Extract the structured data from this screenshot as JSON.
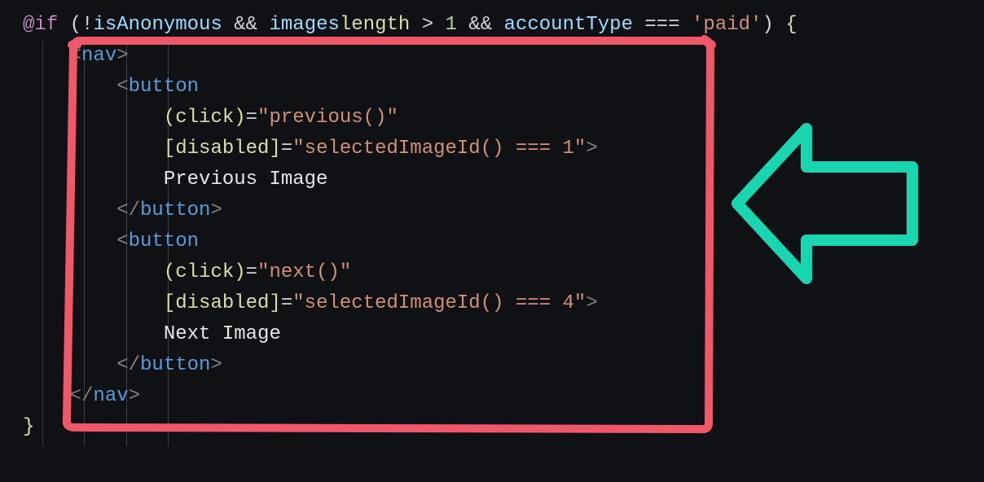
{
  "if_line": {
    "prefix": "@if",
    "cond": {
      "p1a": "(!",
      "v1": "isAnonymous",
      "amp1": " && ",
      "v2": "images",
      ".": ".",
      "prop": "length",
      "gt": " > ",
      "n1": "1",
      "amp2": " && ",
      "v3": "accountType",
      "eq": " === ",
      "str": "'paid'",
      "p1b": ")"
    },
    "brace_open": " {"
  },
  "nav_open": "<nav>",
  "btn1_open": "button",
  "btn1_click_name": "(click)",
  "btn1_click_eq": "=",
  "btn1_click_val": "\"previous()\"",
  "btn1_dis_name": "[disabled]",
  "btn1_dis_eq": "=",
  "btn1_dis_val": "\"selectedImageId() === 1\"",
  "btn1_end": ">",
  "btn1_text": "Previous Image",
  "btn1_close": "button",
  "btn2_open": "button",
  "btn2_click_name": "(click)",
  "btn2_click_eq": "=",
  "btn2_click_val": "\"next()\"",
  "btn2_dis_name": "[disabled]",
  "btn2_dis_eq": "=",
  "btn2_dis_val": "\"selectedImageId() === 4\"",
  "btn2_end": ">",
  "btn2_text": "Next Image",
  "btn2_close": "button",
  "nav_close": "nav",
  "brace_close": "}"
}
